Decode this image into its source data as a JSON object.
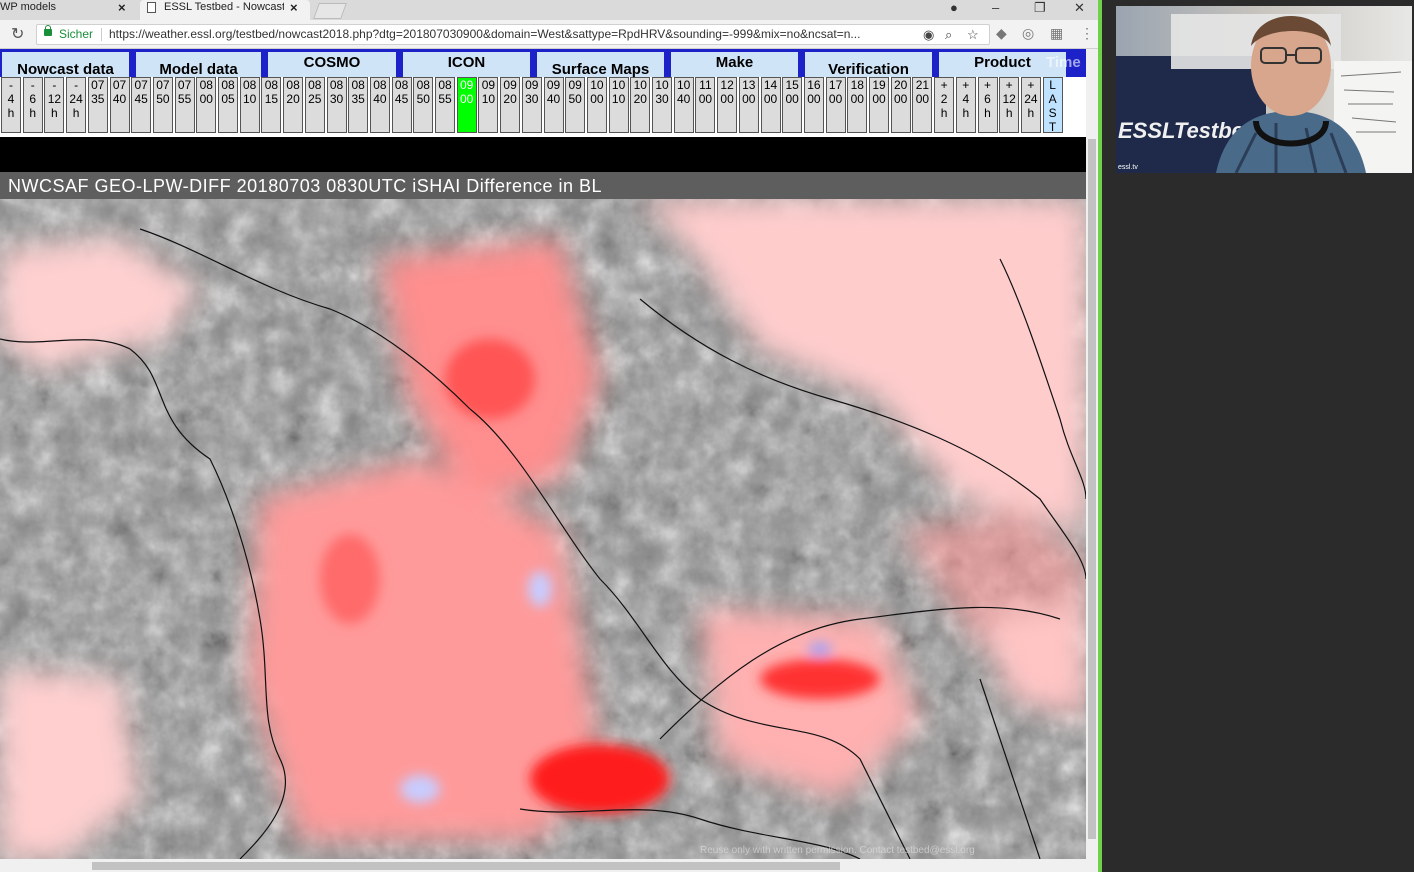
{
  "browser": {
    "tabs": [
      {
        "label": "WP models",
        "close": "×"
      },
      {
        "label": "ESSL Testbed - Nowcast",
        "close": "×"
      }
    ],
    "address": {
      "secure_label": "Sicher",
      "url": "https://weather.essl.org/testbed/nowcast2018.php?dtg=201807030900&domain=West&sattype=RpdHRV&sounding=-999&mix=no&ncsat=n..."
    }
  },
  "nav": {
    "menus": [
      "Nowcast data",
      "Model data",
      "COSMO",
      "ICON",
      "Surface Maps",
      "Make",
      "Verification",
      "Product"
    ],
    "overlay_word": "Time",
    "cells": [
      "-\n4\nh",
      "-\n6\nh",
      "-\n12\nh",
      "-\n24\nh",
      "07\n35",
      "07\n40",
      "07\n45",
      "07\n50",
      "07\n55",
      "08\n00",
      "08\n05",
      "08\n10",
      "08\n15",
      "08\n20",
      "08\n25",
      "08\n30",
      "08\n35",
      "08\n40",
      "08\n45",
      "08\n50",
      "08\n55",
      "09\n00",
      "09\n10",
      "09\n20",
      "09\n30",
      "09\n40",
      "09\n50",
      "10\n00",
      "10\n10",
      "10\n20",
      "10\n30",
      "10\n40",
      "11\n00",
      "12\n00",
      "13\n00",
      "14\n00",
      "15\n00",
      "16\n00",
      "17\n00",
      "18\n00",
      "19\n00",
      "20\n00",
      "21\n00",
      "+\n2\nh",
      "+\n4\nh",
      "+\n6\nh",
      "+\n12\nh",
      "+\n24\nh",
      "L\nA\nS\nT"
    ],
    "active_cell": "09 00",
    "last_cell": "LAST"
  },
  "map": {
    "title": "NWCSAF GEO-LPW-DIFF  20180703 0830UTC  iSHAI Difference in BL",
    "copyright": "Reuse only with written permission. Contact testbed@essl.org",
    "colors": {
      "difference_high": "#ff1a1a",
      "difference_low": "#ffd4d4",
      "cloud": "#a8a8a8",
      "negative": "#c8ccff"
    }
  },
  "video": {
    "caption": "ESSLTestbed",
    "label": "essl.tv"
  }
}
